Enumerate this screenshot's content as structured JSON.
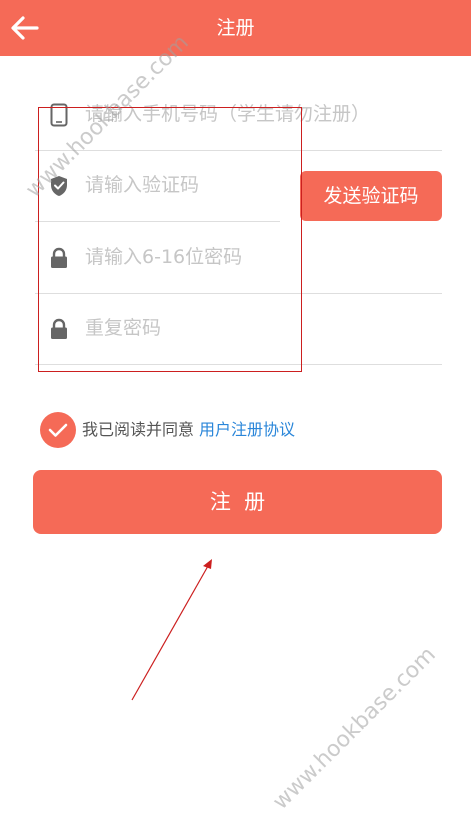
{
  "colors": {
    "accent": "#f56a57",
    "link": "#2a86d9",
    "annotation": "#cc1f1f"
  },
  "header": {
    "title": "注册",
    "back_icon": "arrow-left-icon"
  },
  "form": {
    "phone": {
      "placeholder": "请输入手机号码（学生请勿注册）",
      "icon": "phone-icon",
      "value": ""
    },
    "code": {
      "placeholder": "请输入验证码",
      "icon": "shield-icon",
      "value": ""
    },
    "send_code_label": "发送验证码",
    "password": {
      "placeholder": "请输入6-16位密码",
      "icon": "lock-icon",
      "value": ""
    },
    "repeat_password": {
      "placeholder": "重复密码",
      "icon": "lock-icon",
      "value": ""
    }
  },
  "agreement": {
    "checked": true,
    "text": "我已阅读并同意",
    "link_text": "用户注册协议"
  },
  "register_button_label": "注  册",
  "watermarks": [
    "www.hookbase.com",
    "www.hookbase.com"
  ]
}
